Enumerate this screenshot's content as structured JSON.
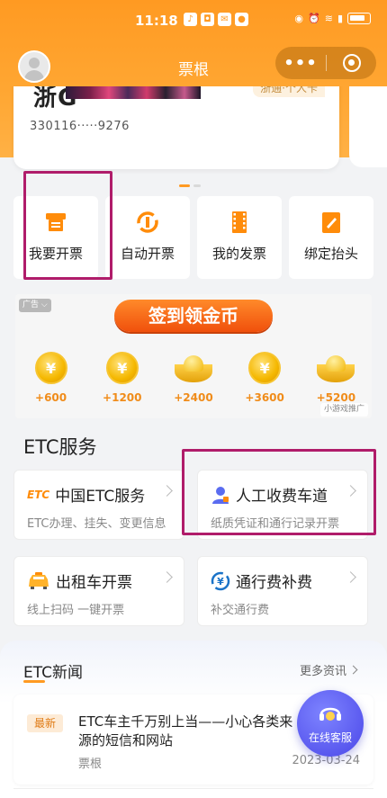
{
  "status_bar": {
    "time": "11:18",
    "icons": [
      "tiktok-icon",
      "chat-icon",
      "app-icon",
      "qq-icon"
    ],
    "right_icons": [
      "eye-icon",
      "alarm-icon",
      "wifi-icon",
      "signal-icon",
      "battery-icon"
    ]
  },
  "nav": {
    "title": "票根",
    "more": "•••",
    "close": "◉"
  },
  "card": {
    "plate_prefix": "浙G",
    "tag": "浙通·个人卡",
    "number": "330116·····9276"
  },
  "actions": [
    {
      "label": "我要开票",
      "icon": "invoice-icon"
    },
    {
      "label": "自动开票",
      "icon": "auto-invoice-icon"
    },
    {
      "label": "我的发票",
      "icon": "film-invoice-icon"
    },
    {
      "label": "绑定抬头",
      "icon": "edit-header-icon"
    }
  ],
  "ad": {
    "tag": "广告 ⌵",
    "button": "签到领金币",
    "rewards": [
      {
        "value": "+600",
        "kind": "coin"
      },
      {
        "value": "+1200",
        "kind": "coin"
      },
      {
        "value": "+2400",
        "kind": "ingot"
      },
      {
        "value": "+3600",
        "kind": "coin"
      },
      {
        "value": "+5200",
        "kind": "ingot"
      }
    ],
    "source": "小游戏推广"
  },
  "etc_section": {
    "title": "ETC服务",
    "services": [
      {
        "title": "中国ETC服务",
        "sub": "ETC办理、挂失、变更信息",
        "icon_text": "ETC"
      },
      {
        "title": "人工收费车道",
        "sub": "纸质凭证和通行记录开票",
        "icon_text": ""
      },
      {
        "title": "出租车开票",
        "sub": "线上扫码 一键开票",
        "icon_text": ""
      },
      {
        "title": "通行费补费",
        "sub": "补交通行费",
        "icon_text": "¥"
      }
    ]
  },
  "news": {
    "title": "ETC新闻",
    "more": "更多资讯",
    "items": [
      {
        "badge": "最新",
        "headline": "ETC车主千万别上当——小心各类来源的短信和网站",
        "source": "票根",
        "date": "2023-03-24"
      }
    ]
  },
  "fab": {
    "label": "在线客服"
  },
  "colors": {
    "accent": "#ff9a22",
    "highlight_box": "#b01c6a",
    "fab": "#4a46e8"
  }
}
